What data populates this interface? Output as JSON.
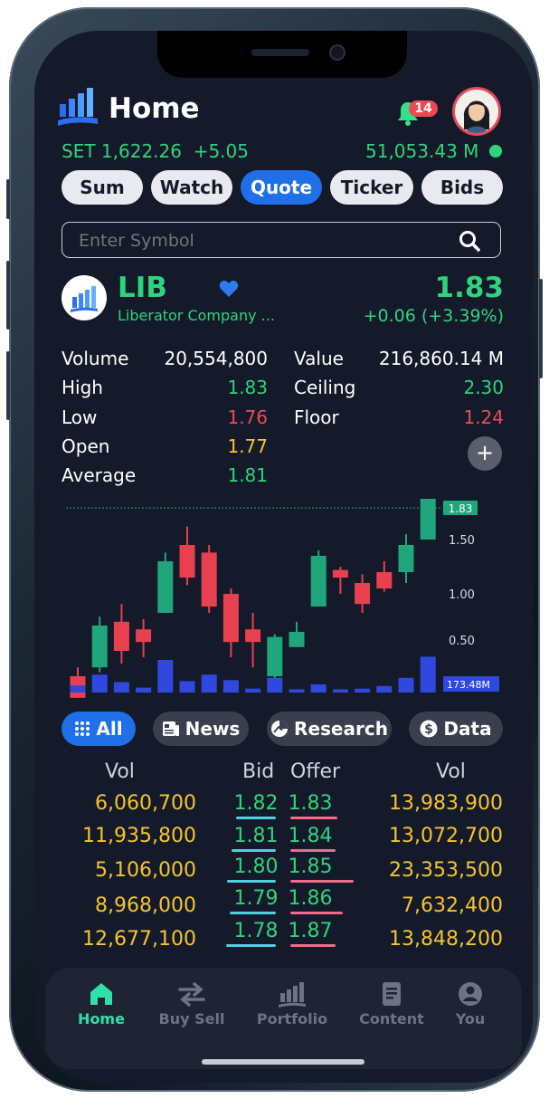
{
  "header": {
    "title": "Home",
    "notification_count": "14"
  },
  "market": {
    "index_label": "SET",
    "index_value": "1,622.26",
    "index_change": "+5.05",
    "turnover": "51,053.43 M"
  },
  "tabs": [
    {
      "label": "Sum"
    },
    {
      "label": "Watch"
    },
    {
      "label": "Quote"
    },
    {
      "label": "Ticker"
    },
    {
      "label": "Bids"
    }
  ],
  "active_tab": "Quote",
  "search": {
    "placeholder": "Enter Symbol"
  },
  "stock": {
    "symbol": "LIB",
    "name": "Liberator Company ...",
    "price": "1.83",
    "change": "+0.06",
    "change_pct": "(+3.39%)"
  },
  "stats_left": [
    {
      "label": "Volume",
      "value": "20,554,800"
    },
    {
      "label": "High",
      "value": "1.83"
    },
    {
      "label": "Low",
      "value": "1.76"
    },
    {
      "label": "Open",
      "value": "1.77"
    },
    {
      "label": "Average",
      "value": "1.81"
    }
  ],
  "stats_right": [
    {
      "label": "Value",
      "value": "216,860.14 M"
    },
    {
      "label": "Ceiling",
      "value": "2.30"
    },
    {
      "label": "Floor",
      "value": "1.24"
    }
  ],
  "chart_data": {
    "type": "candlestick",
    "y_ticks": [
      "1.50",
      "1.00",
      "0.50"
    ],
    "last_price_label": "1.83",
    "volume_label": "173.48M",
    "candles": [
      {
        "open": 0.35,
        "close": 0.18,
        "high": 0.42,
        "low": 0.12,
        "volume": 0.22
      },
      {
        "open": 0.42,
        "close": 0.75,
        "high": 0.82,
        "low": 0.38,
        "volume": 0.55
      },
      {
        "open": 0.78,
        "close": 0.55,
        "high": 0.92,
        "low": 0.45,
        "volume": 0.32
      },
      {
        "open": 0.72,
        "close": 0.62,
        "high": 0.8,
        "low": 0.5,
        "volume": 0.15
      },
      {
        "open": 0.85,
        "close": 1.3,
        "high": 1.38,
        "low": 0.85,
        "volume": 1.0
      },
      {
        "open": 1.45,
        "close": 1.15,
        "high": 1.62,
        "low": 1.08,
        "volume": 0.35
      },
      {
        "open": 1.38,
        "close": 0.9,
        "high": 1.45,
        "low": 0.85,
        "volume": 0.55
      },
      {
        "open": 1.0,
        "close": 0.62,
        "high": 1.05,
        "low": 0.5,
        "volume": 0.38
      },
      {
        "open": 0.72,
        "close": 0.62,
        "high": 0.85,
        "low": 0.42,
        "volume": 0.12
      },
      {
        "open": 0.35,
        "close": 0.66,
        "high": 0.68,
        "low": 0.28,
        "volume": 0.45
      },
      {
        "open": 0.58,
        "close": 0.7,
        "high": 0.78,
        "low": 0.58,
        "volume": 0.1
      },
      {
        "open": 0.9,
        "close": 1.35,
        "high": 1.4,
        "low": 0.9,
        "volume": 0.25
      },
      {
        "open": 1.22,
        "close": 1.15,
        "high": 1.25,
        "low": 1.0,
        "volume": 0.1
      },
      {
        "open": 1.1,
        "close": 0.92,
        "high": 1.18,
        "low": 0.85,
        "volume": 0.12
      },
      {
        "open": 1.2,
        "close": 1.05,
        "high": 1.3,
        "low": 1.02,
        "volume": 0.2
      },
      {
        "open": 1.2,
        "close": 1.45,
        "high": 1.55,
        "low": 1.1,
        "volume": 0.45
      },
      {
        "open": 1.5,
        "close": 1.93,
        "high": 1.98,
        "low": 1.5,
        "volume": 1.1
      }
    ]
  },
  "filters": [
    {
      "label": "All",
      "icon": "grid-icon"
    },
    {
      "label": "News",
      "icon": "newspaper-icon"
    },
    {
      "label": "Research",
      "icon": "chart-pie-icon"
    },
    {
      "label": "Data",
      "icon": "dollar-icon"
    }
  ],
  "bids_header": {
    "vol_left": "Vol",
    "bid": "Bid",
    "offer": "Offer",
    "vol_right": "Vol"
  },
  "bids": [
    {
      "bid_vol": "6,060,700",
      "bid": "1.82",
      "offer": "1.83",
      "offer_vol": "13,983,900"
    },
    {
      "bid_vol": "11,935,800",
      "bid": "1.81",
      "offer": "1.84",
      "offer_vol": "13,072,700"
    },
    {
      "bid_vol": "5,106,000",
      "bid": "1.80",
      "offer": "1.85",
      "offer_vol": "23,353,500"
    },
    {
      "bid_vol": "8,968,000",
      "bid": "1.79",
      "offer": "1.86",
      "offer_vol": "7,632,400"
    },
    {
      "bid_vol": "12,677,100",
      "bid": "1.78",
      "offer": "1.87",
      "offer_vol": "13,848,200"
    }
  ],
  "nav": [
    {
      "label": "Home",
      "icon": "home-icon"
    },
    {
      "label": "Buy Sell",
      "icon": "swap-icon"
    },
    {
      "label": "Portfolio",
      "icon": "portfolio-icon"
    },
    {
      "label": "Content",
      "icon": "document-icon"
    },
    {
      "label": "You",
      "icon": "user-icon"
    }
  ],
  "colors": {
    "bg": "#141a29",
    "accent": "#1e6fe8",
    "up": "#2fd37c",
    "down": "#ef4b55",
    "volume": "#eec235",
    "candle_up": "#1fa67a",
    "candle_down": "#e8404f",
    "vol_bar": "#3148e0"
  }
}
